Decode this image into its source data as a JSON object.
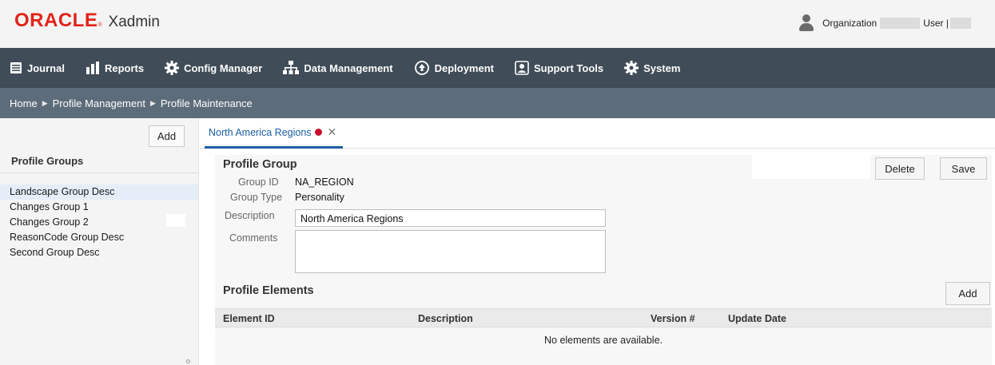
{
  "header": {
    "brand": "ORACLE",
    "brand_mark": "®",
    "app_name": "Xadmin",
    "org_label": "Organization",
    "user_label": "User |"
  },
  "nav": {
    "items": [
      {
        "label": "Journal",
        "icon": "journal-icon"
      },
      {
        "label": "Reports",
        "icon": "bar-chart-icon"
      },
      {
        "label": "Config Manager",
        "icon": "gear-icon"
      },
      {
        "label": "Data Management",
        "icon": "hierarchy-icon"
      },
      {
        "label": "Deployment",
        "icon": "cloud-upload-icon"
      },
      {
        "label": "Support Tools",
        "icon": "support-icon"
      },
      {
        "label": "System",
        "icon": "gear-icon"
      }
    ]
  },
  "breadcrumb": {
    "items": [
      "Home",
      "Profile Management",
      "Profile Maintenance"
    ],
    "separator": "▶"
  },
  "sidebar": {
    "add_label": "Add",
    "title": "Profile Groups",
    "items": [
      "Landscape Group Desc",
      "Changes Group 1",
      "Changes Group 2",
      "ReasonCode Group Desc",
      "Second Group Desc"
    ],
    "selected_index": 0
  },
  "tab": {
    "label": "North America Regions",
    "close": "✕"
  },
  "profile_group": {
    "heading": "Profile Group",
    "delete_label": "Delete",
    "save_label": "Save",
    "group_id_label": "Group ID",
    "group_id": "NA_REGION",
    "group_type_label": "Group Type",
    "group_type": "Personality",
    "description_label": "Description",
    "description": "North America Regions",
    "comments_label": "Comments",
    "comments": ""
  },
  "profile_elements": {
    "heading": "Profile Elements",
    "add_label": "Add",
    "columns": [
      "Element ID",
      "Description",
      "Version #",
      "Update Date"
    ],
    "empty_message": "No elements are available."
  },
  "colors": {
    "brand_red": "#e2231a",
    "nav_bg": "#404c57",
    "breadcrumb_bg": "#5d6c7a",
    "tab_accent": "#1b5ea3",
    "unsaved_dot": "#c8102e"
  }
}
